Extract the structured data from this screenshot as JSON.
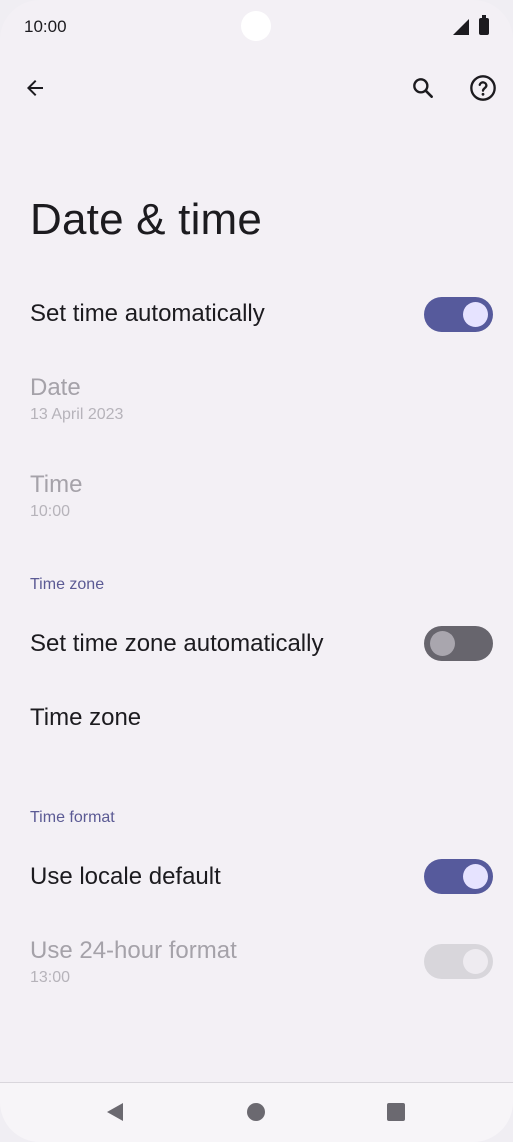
{
  "status_bar": {
    "time": "10:00"
  },
  "header": {
    "title": "Date & time"
  },
  "settings": {
    "set_time_automatically": {
      "label": "Set time automatically",
      "enabled": true
    },
    "date": {
      "label": "Date",
      "value": "13 April 2023"
    },
    "time": {
      "label": "Time",
      "value": "10:00"
    },
    "time_zone_section": {
      "header": "Time zone"
    },
    "set_time_zone_automatically": {
      "label": "Set time zone automatically",
      "enabled": false
    },
    "time_zone": {
      "label": "Time zone"
    },
    "time_format_section": {
      "header": "Time format"
    },
    "use_locale_default": {
      "label": "Use locale default",
      "enabled": true
    },
    "use_24_hour": {
      "label": "Use 24-hour format",
      "value": "13:00",
      "enabled": true,
      "disabled": true
    }
  },
  "icons": {
    "back": "arrow-back-icon",
    "search": "search-icon",
    "help": "help-icon",
    "nav_back": "nav-back-icon",
    "nav_home": "nav-home-icon",
    "nav_recents": "nav-recents-icon"
  },
  "colors": {
    "accent": "#565a9c",
    "section_header": "#5b5a94",
    "background": "#f3f0f5"
  }
}
